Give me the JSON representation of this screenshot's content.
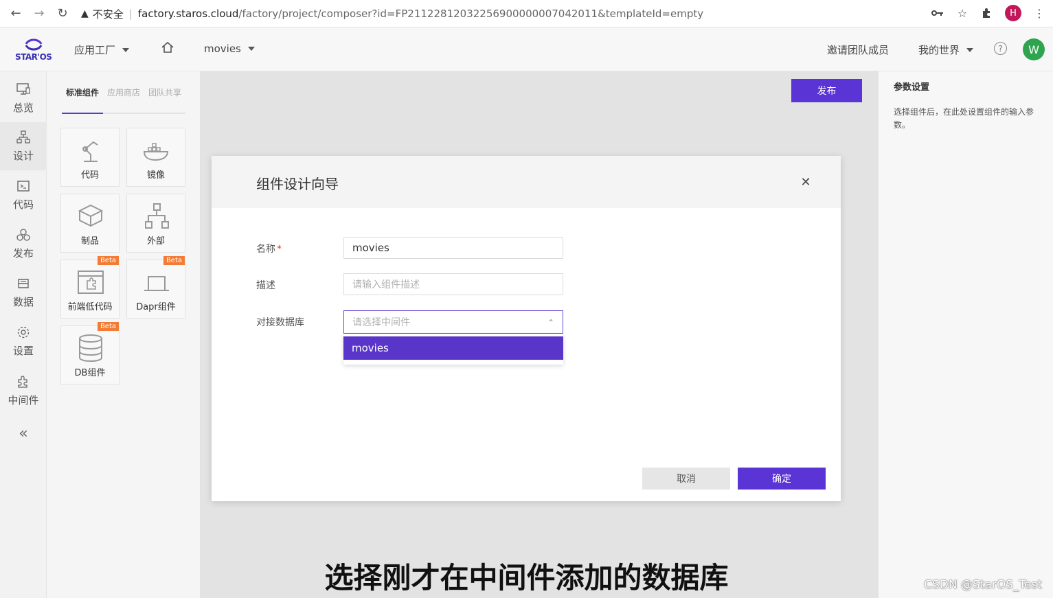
{
  "browser": {
    "insecure_label": "不安全",
    "url_host": "factory.staros.cloud",
    "url_path": "/factory/project/composer?id=FP211228120322569000000070420​11&templateId=empty",
    "profile_letter": "H"
  },
  "header": {
    "logo_text": "STAR'OS",
    "app_factory": "应用工厂",
    "project": "movies",
    "invite": "邀请团队成员",
    "my_world": "我的世界",
    "help": "?",
    "avatar_letter": "W"
  },
  "leftnav": {
    "items": [
      {
        "label": "总览",
        "icon": "monitor-icon"
      },
      {
        "label": "设计",
        "icon": "design-icon"
      },
      {
        "label": "代码",
        "icon": "terminal-icon"
      },
      {
        "label": "发布",
        "icon": "publish-icon"
      },
      {
        "label": "数据",
        "icon": "database-icon"
      },
      {
        "label": "设置",
        "icon": "gear-icon"
      },
      {
        "label": "中间件",
        "icon": "puzzle-icon"
      }
    ],
    "collapse": "«"
  },
  "components": {
    "tabs": [
      "标准组件",
      "应用商店",
      "团队共享"
    ],
    "cards": [
      {
        "label": "代码",
        "beta": ""
      },
      {
        "label": "镜像",
        "beta": ""
      },
      {
        "label": "制品",
        "beta": ""
      },
      {
        "label": "外部",
        "beta": ""
      },
      {
        "label": "前端低代码",
        "beta": "Beta"
      },
      {
        "label": "Dapr组件",
        "beta": "Beta"
      },
      {
        "label": "DB组件",
        "beta": "Beta"
      }
    ]
  },
  "canvas": {
    "publish_label": "发布"
  },
  "params": {
    "title": "参数设置",
    "description": "选择组件后，在此处设置组件的输入参数。"
  },
  "modal": {
    "title": "组件设计向导",
    "name_label": "名称",
    "required_mark": "*",
    "name_value": "movies",
    "desc_label": "描述",
    "desc_placeholder": "请输入组件描述",
    "db_label": "对接数据库",
    "db_placeholder": "请选择中间件",
    "db_options": [
      "movies"
    ],
    "cancel_label": "取消",
    "ok_label": "确定"
  },
  "overlay": {
    "subtitle": "选择刚才在中间件添加的数据库",
    "watermark": "CSDN @StarOS_Test"
  },
  "colors": {
    "accent": "#5b34d6",
    "avatar": "#2ea44f",
    "beta": "#f27b35",
    "required": "#e53935"
  }
}
